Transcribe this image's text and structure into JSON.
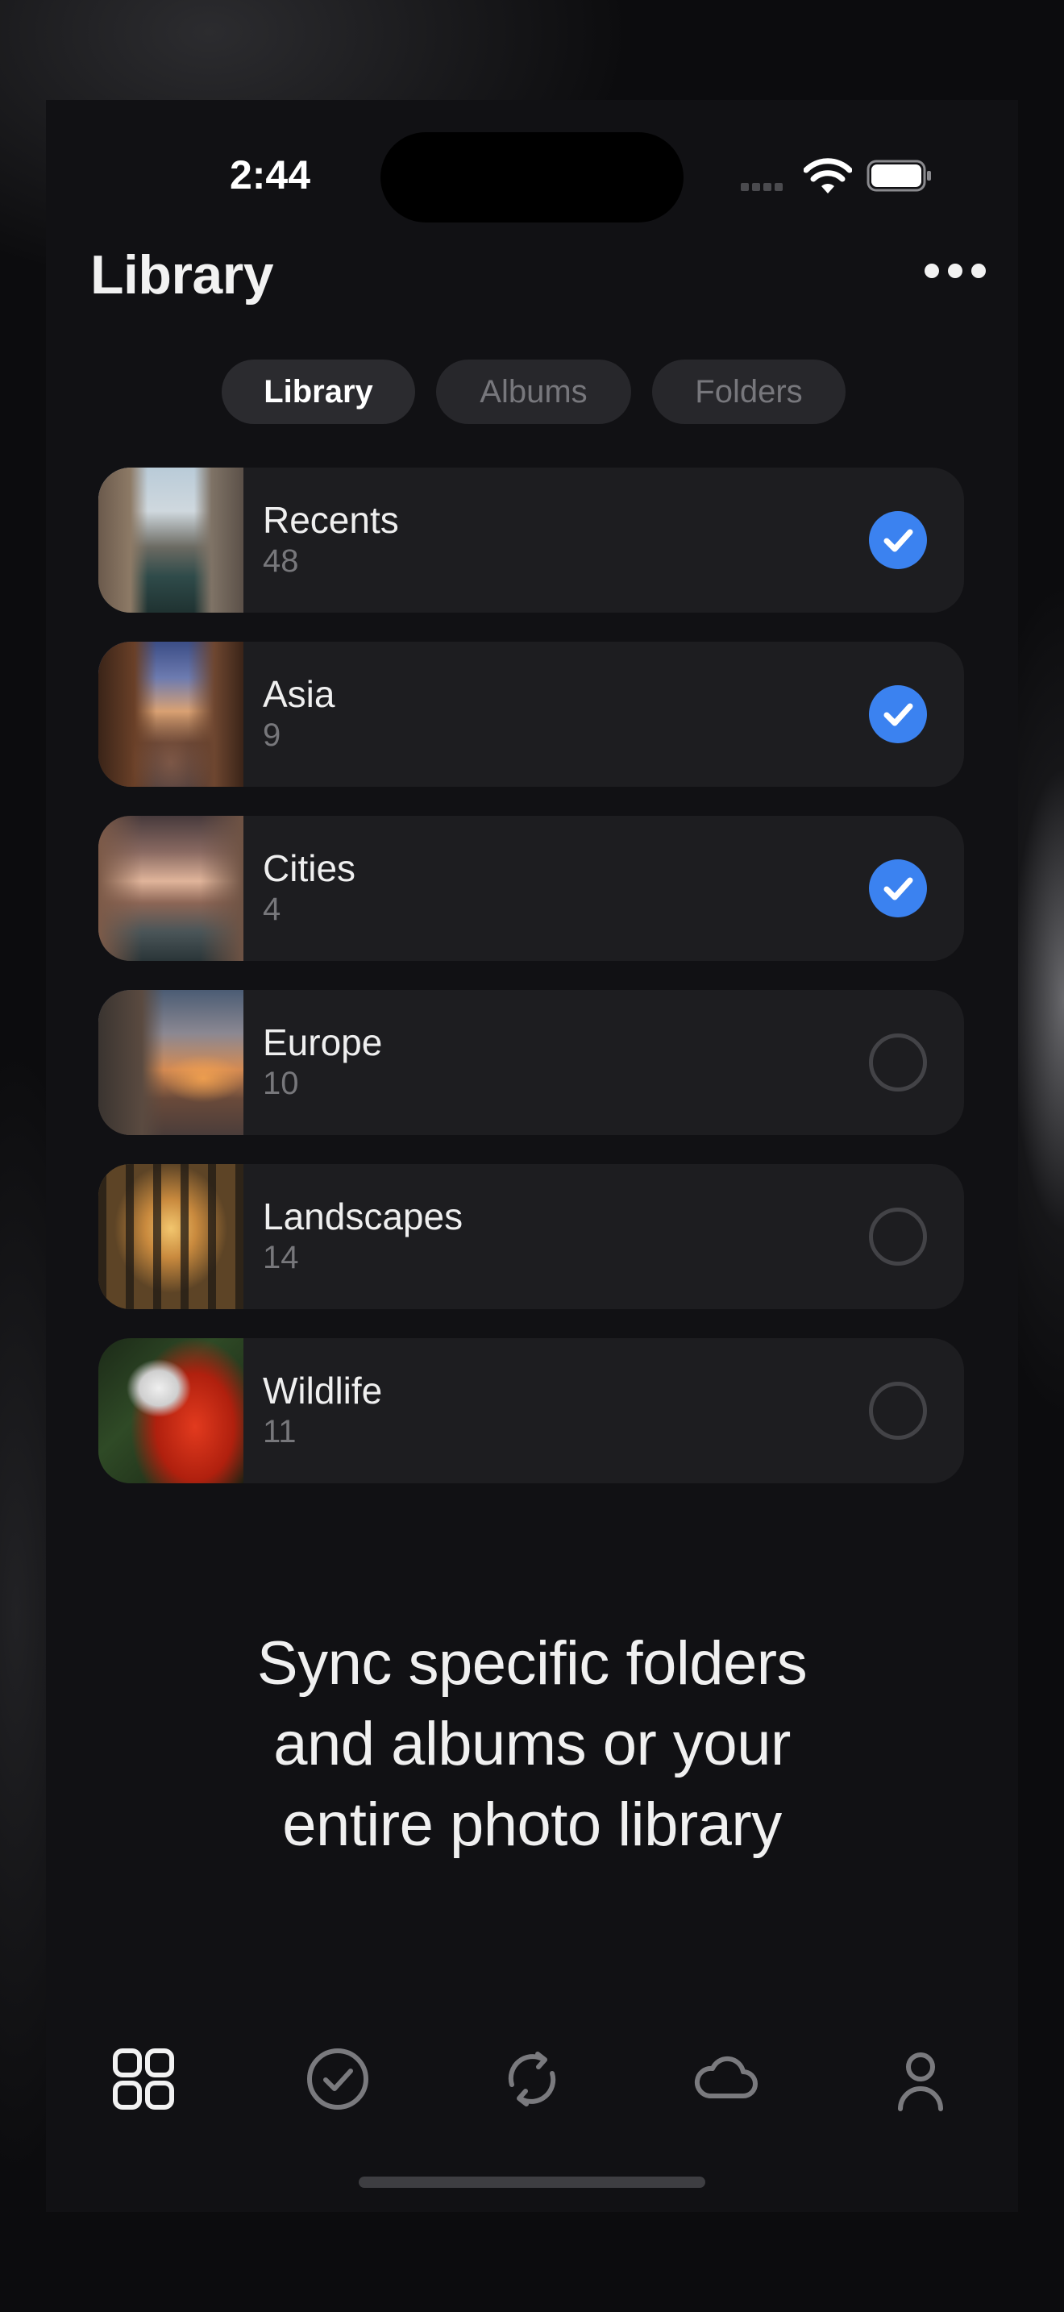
{
  "status_bar": {
    "time": "2:44"
  },
  "header": {
    "title": "Library",
    "more_icon": "ellipsis-icon"
  },
  "tabs": [
    {
      "label": "Library",
      "active": true
    },
    {
      "label": "Albums",
      "active": false
    },
    {
      "label": "Folders",
      "active": false
    }
  ],
  "albums": [
    {
      "name": "Recents",
      "count": "48",
      "selected": true
    },
    {
      "name": "Asia",
      "count": "9",
      "selected": true
    },
    {
      "name": "Cities",
      "count": "4",
      "selected": true
    },
    {
      "name": "Europe",
      "count": "10",
      "selected": false
    },
    {
      "name": "Landscapes",
      "count": "14",
      "selected": false
    },
    {
      "name": "Wildlife",
      "count": "11",
      "selected": false
    }
  ],
  "tagline": {
    "line1": "Sync specific folders",
    "line2": "and albums or your",
    "line3": "entire photo library"
  },
  "tab_bar": {
    "items": [
      "grid-icon",
      "checkmark-circle-icon",
      "sync-icon",
      "cloud-icon",
      "person-icon"
    ],
    "active_index": 0
  },
  "colors": {
    "accent": "#3b82f0",
    "background": "#111114",
    "row_background": "#1d1d20"
  }
}
